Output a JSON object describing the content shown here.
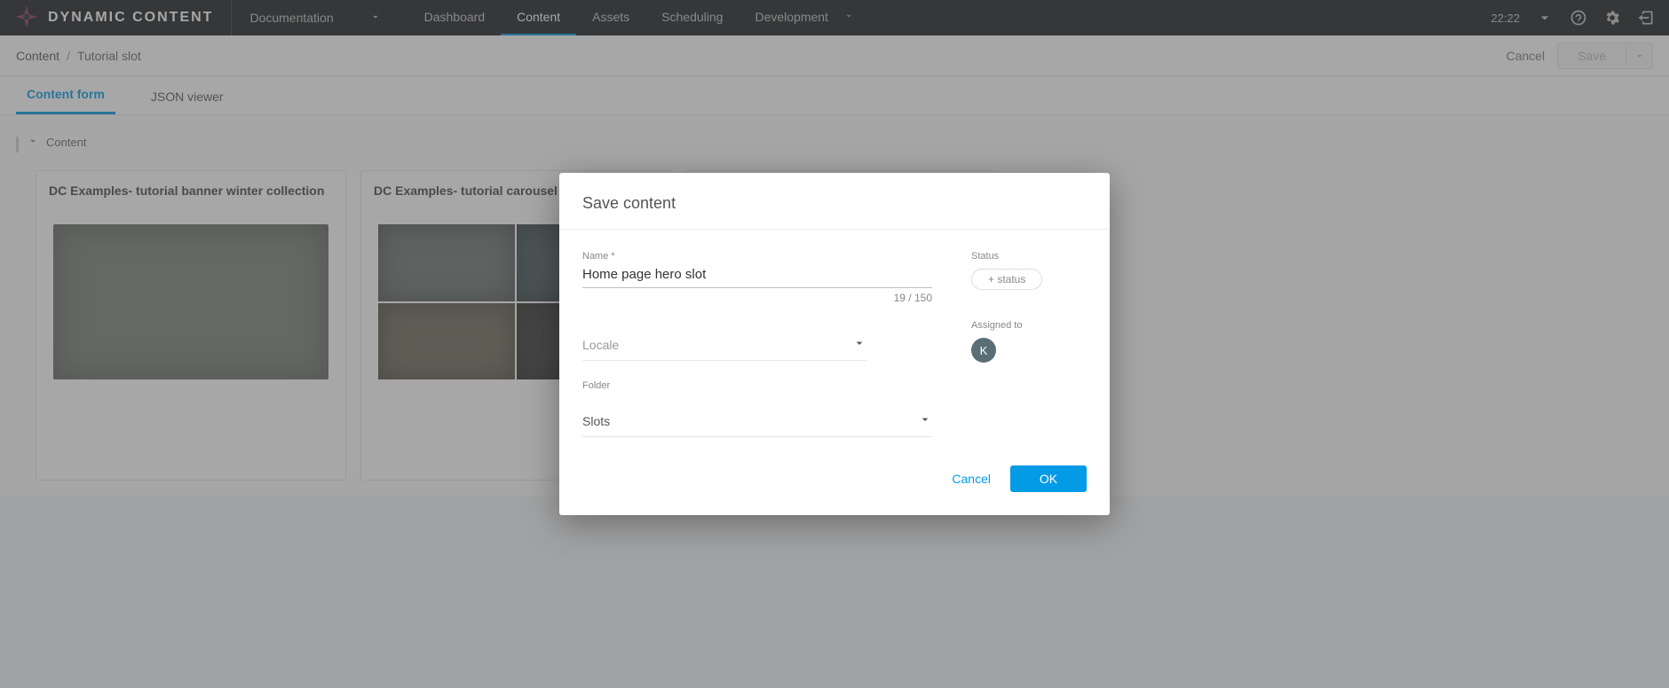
{
  "header": {
    "logo_text": "DYNAMIC CONTENT",
    "hub_selector": "Documentation",
    "nav": {
      "dashboard": "Dashboard",
      "content": "Content",
      "assets": "Assets",
      "scheduling": "Scheduling",
      "development": "Development"
    },
    "time": "22:22"
  },
  "subheader": {
    "breadcrumb": {
      "root": "Content",
      "sep": "/",
      "current": "Tutorial slot"
    },
    "cancel": "Cancel",
    "save": "Save"
  },
  "tabs": {
    "content_form": "Content form",
    "json_viewer": "JSON viewer"
  },
  "section": {
    "label": "Content"
  },
  "cards": [
    {
      "title": "DC Examples- tutorial banner winter collection",
      "kind": "single-photo"
    },
    {
      "title": "DC Examples- tutorial carousel",
      "kind": "carousel"
    },
    {
      "title": "",
      "kind": "add"
    }
  ],
  "modal": {
    "title": "Save content",
    "name_label": "Name *",
    "name_value": "Home page hero slot",
    "counter": "19 / 150",
    "locale_label": "Locale",
    "folder_label": "Folder",
    "folder_value": "Slots",
    "status_label": "Status",
    "add_status": "+ status",
    "assigned_label": "Assigned to",
    "assigned_initial": "K",
    "cancel": "Cancel",
    "ok": "OK"
  }
}
